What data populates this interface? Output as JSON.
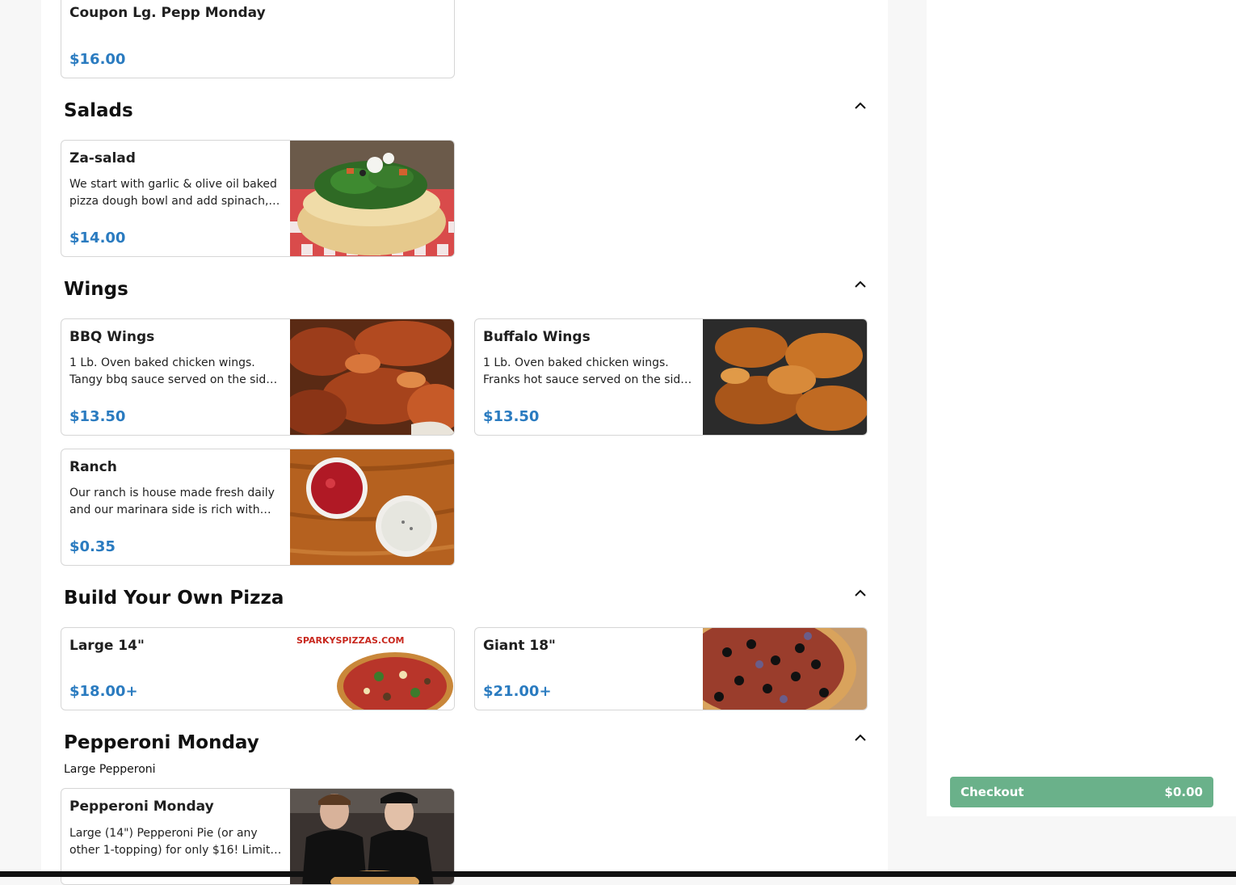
{
  "menu": {
    "top_item": {
      "name": "Coupon Lg. Pepp Monday",
      "price": "$16.00"
    },
    "sections": {
      "salads": {
        "title": "Salads",
        "items": [
          {
            "name": "Za-salad",
            "desc": "We start with garlic & olive oil baked pizza dough bowl and add spinach,…",
            "price": "$14.00"
          }
        ]
      },
      "wings": {
        "title": "Wings",
        "items": [
          {
            "name": "BBQ Wings",
            "desc": "1 Lb. Oven baked chicken wings. Tangy bbq sauce served on the sid…",
            "price": "$13.50"
          },
          {
            "name": "Buffalo Wings",
            "desc": "1 Lb. Oven baked chicken wings. Franks hot sauce served on the sid…",
            "price": "$13.50"
          },
          {
            "name": "Ranch",
            "desc": "Our ranch is house made fresh daily and our marinara side is rich with…",
            "price": "$0.35"
          }
        ]
      },
      "byo": {
        "title": "Build Your Own Pizza",
        "items": [
          {
            "name": "Large 14\"",
            "price": "$18.00+",
            "img_text": "SPARKYSPIZZAS.COM"
          },
          {
            "name": "Giant 18\"",
            "price": "$21.00+"
          }
        ]
      },
      "pepperoni": {
        "title": "Pepperoni Monday",
        "subtitle": "Large Pepperoni",
        "items": [
          {
            "name": "Pepperoni Monday",
            "desc": "Large (14\") Pepperoni Pie (or any other 1-topping) for only $16! Limit…"
          }
        ]
      }
    }
  },
  "cart": {
    "checkout_label": "Checkout",
    "total": "$0.00"
  },
  "icons": {
    "collapse": "chevron-up-icon"
  },
  "colors": {
    "price": "#2a7bc0",
    "checkout": "#6ab18a"
  }
}
